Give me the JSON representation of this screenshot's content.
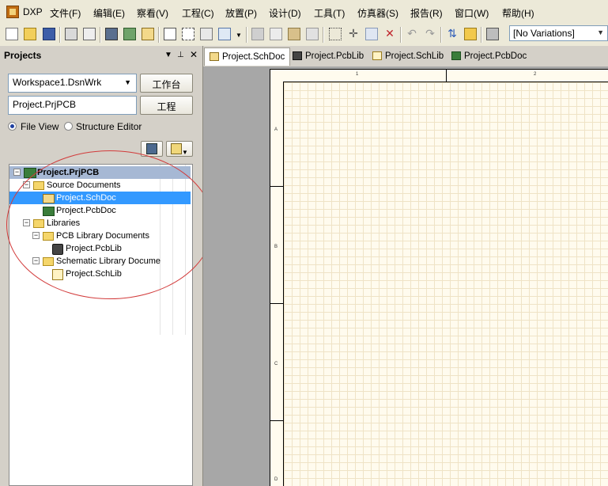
{
  "menu": {
    "items": [
      "DXP",
      "文件(F)",
      "编辑(E)",
      "察看(V)",
      "工程(C)",
      "放置(P)",
      "设计(D)",
      "工具(T)",
      "仿真器(S)",
      "报告(R)",
      "窗口(W)",
      "帮助(H)"
    ]
  },
  "toolbar": {
    "variations_value": "[No Variations]"
  },
  "projects_panel": {
    "title": "Projects",
    "workspace_value": "Workspace1.DsnWrk",
    "workspace_button": "工作台",
    "project_value": "Project.PrjPCB",
    "project_button": "工程",
    "view_options": [
      "File View",
      "Structure Editor"
    ],
    "selected_view": "File View"
  },
  "tree": {
    "root": "Project.PrjPCB",
    "source_documents": "Source Documents",
    "schdoc": "Project.SchDoc",
    "pcbdoc": "Project.PcbDoc",
    "libraries": "Libraries",
    "pcb_library_documents": "PCB Library Documents",
    "pcblib": "Project.PcbLib",
    "schematic_library_documents": "Schematic Library Docume",
    "schlib": "Project.SchLib",
    "selected": "Project.SchDoc"
  },
  "doc_tabs": [
    "Project.SchDoc",
    "Project.PcbLib",
    "Project.SchLib",
    "Project.PcbDoc"
  ],
  "active_tab": "Project.SchDoc",
  "sheet": {
    "zone_columns": [
      "1",
      "2"
    ],
    "zone_rows": [
      "A",
      "B",
      "C",
      "D"
    ]
  },
  "colors": {
    "selection": "#3399ff",
    "annotation": "#d23b3b",
    "sheet": "#fffbee"
  }
}
